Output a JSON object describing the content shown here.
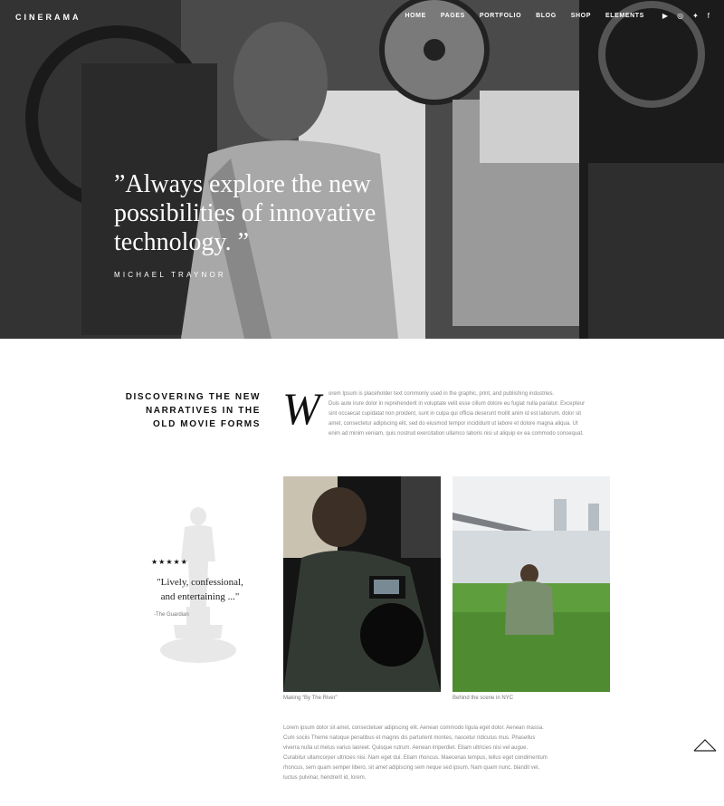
{
  "header": {
    "logo": "CINERAMA",
    "nav": [
      "HOME",
      "PAGES",
      "PORTFOLIO",
      "BLOG",
      "SHOP",
      "ELEMENTS"
    ],
    "social": [
      {
        "icon": "youtube-icon",
        "glyph": "▶"
      },
      {
        "icon": "instagram-icon",
        "glyph": "◎"
      },
      {
        "icon": "twitter-icon",
        "glyph": "✦"
      },
      {
        "icon": "facebook-icon",
        "glyph": "f"
      }
    ]
  },
  "hero": {
    "quote": "”Always explore the new possibilities of innovative technology. ”",
    "author": "MICHAEL TRAYNOR"
  },
  "intro": {
    "title": "DISCOVERING THE NEW NARRATIVES IN THE OLD MOVIE FORMS",
    "dropcap": "W",
    "text_first": "orem Ipsum is placeholder text commonly used in the graphic, print, and publishing industries.",
    "text_rest": "Duis aute irure dolor in reprehenderit in voluptate velit esse cillum dolore eu fugiat nulla pariatur. Excepteur sint occaecat cupidatat non proident, sunt in culpa qui officia deserunt mollit anim id est laborum. dolor sit amet, consectetur adipiscing elit, sed do eiusmod tempor incididunt ut labore et dolore magna aliqua. Ut enim ad minim veniam, quis nostrud exercitation ullamco laboris nisi ut aliquip ex ea commodo consequat."
  },
  "award": {
    "stars": "★★★★★",
    "quote": "\"Lively, confessional, and entertaining ...\"",
    "source": "-The Guardian"
  },
  "photos": [
    {
      "caption": "Making “By The River”"
    },
    {
      "caption": "Behind the scene in NYC"
    }
  ],
  "body_text": "Lorem ipsum dolor sit amet, consectetuer adipiscing elit. Aenean commodo ligula eget dolor. Aenean massa. Cum sociis Theme natoque penatibus et magnis dis parturient montes, nascetur ridiculus mus. Phasellus viverra nulla ut metus varius laoreet. Quisque rutrum. Aenean imperdiet. Etiam ultricies nisi vel augue. Curabitur ullamcorper ultricies nisi. Nam eget dui. Etiam rhoncus. Maecenas tempus, tellus eget condimentum rhoncus, sem quam semper libero, sit amet adipiscing sem neque sed ipsum. Nam quam nunc, blandit vel, luctus pulvinar, hendrerit id, lorem."
}
